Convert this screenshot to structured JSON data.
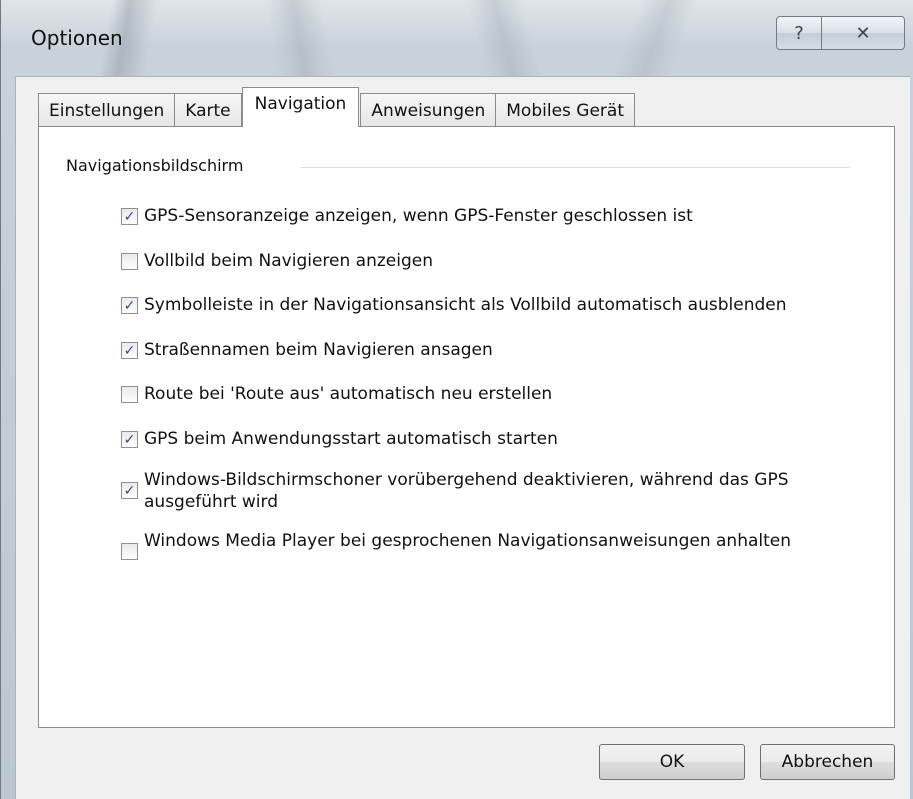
{
  "window": {
    "title": "Optionen",
    "help_glyph": "?",
    "close_glyph": "✕"
  },
  "tabs": [
    {
      "label": "Einstellungen",
      "active": false
    },
    {
      "label": "Karte",
      "active": false
    },
    {
      "label": "Navigation",
      "active": true
    },
    {
      "label": "Anweisungen",
      "active": false
    },
    {
      "label": "Mobiles Gerät",
      "active": false
    }
  ],
  "group": {
    "label": "Navigationsbildschirm"
  },
  "options": [
    {
      "label": "GPS-Sensoranzeige anzeigen, wenn GPS-Fenster geschlossen ist",
      "checked": true
    },
    {
      "label": "Vollbild beim Navigieren anzeigen",
      "checked": false
    },
    {
      "label": "Symbolleiste in der Navigationsansicht als Vollbild automatisch ausblenden",
      "checked": true
    },
    {
      "label": "Straßennamen beim Navigieren ansagen",
      "checked": true
    },
    {
      "label": "Route bei 'Route aus' automatisch neu erstellen",
      "checked": false
    },
    {
      "label": "GPS beim Anwendungsstart automatisch starten",
      "checked": true
    },
    {
      "label": "Windows-Bildschirmschoner vorübergehend deaktivieren, während das GPS ausgeführt wird",
      "checked": true
    },
    {
      "label": "Windows Media Player bei gesprochenen Navigationsanweisungen anhalten",
      "checked": false
    }
  ],
  "buttons": {
    "ok": "OK",
    "cancel": "Abbrechen"
  },
  "colors": {
    "checkmark": "#2b4c8c",
    "panel_border": "#898c95"
  },
  "check_glyph": "✓"
}
